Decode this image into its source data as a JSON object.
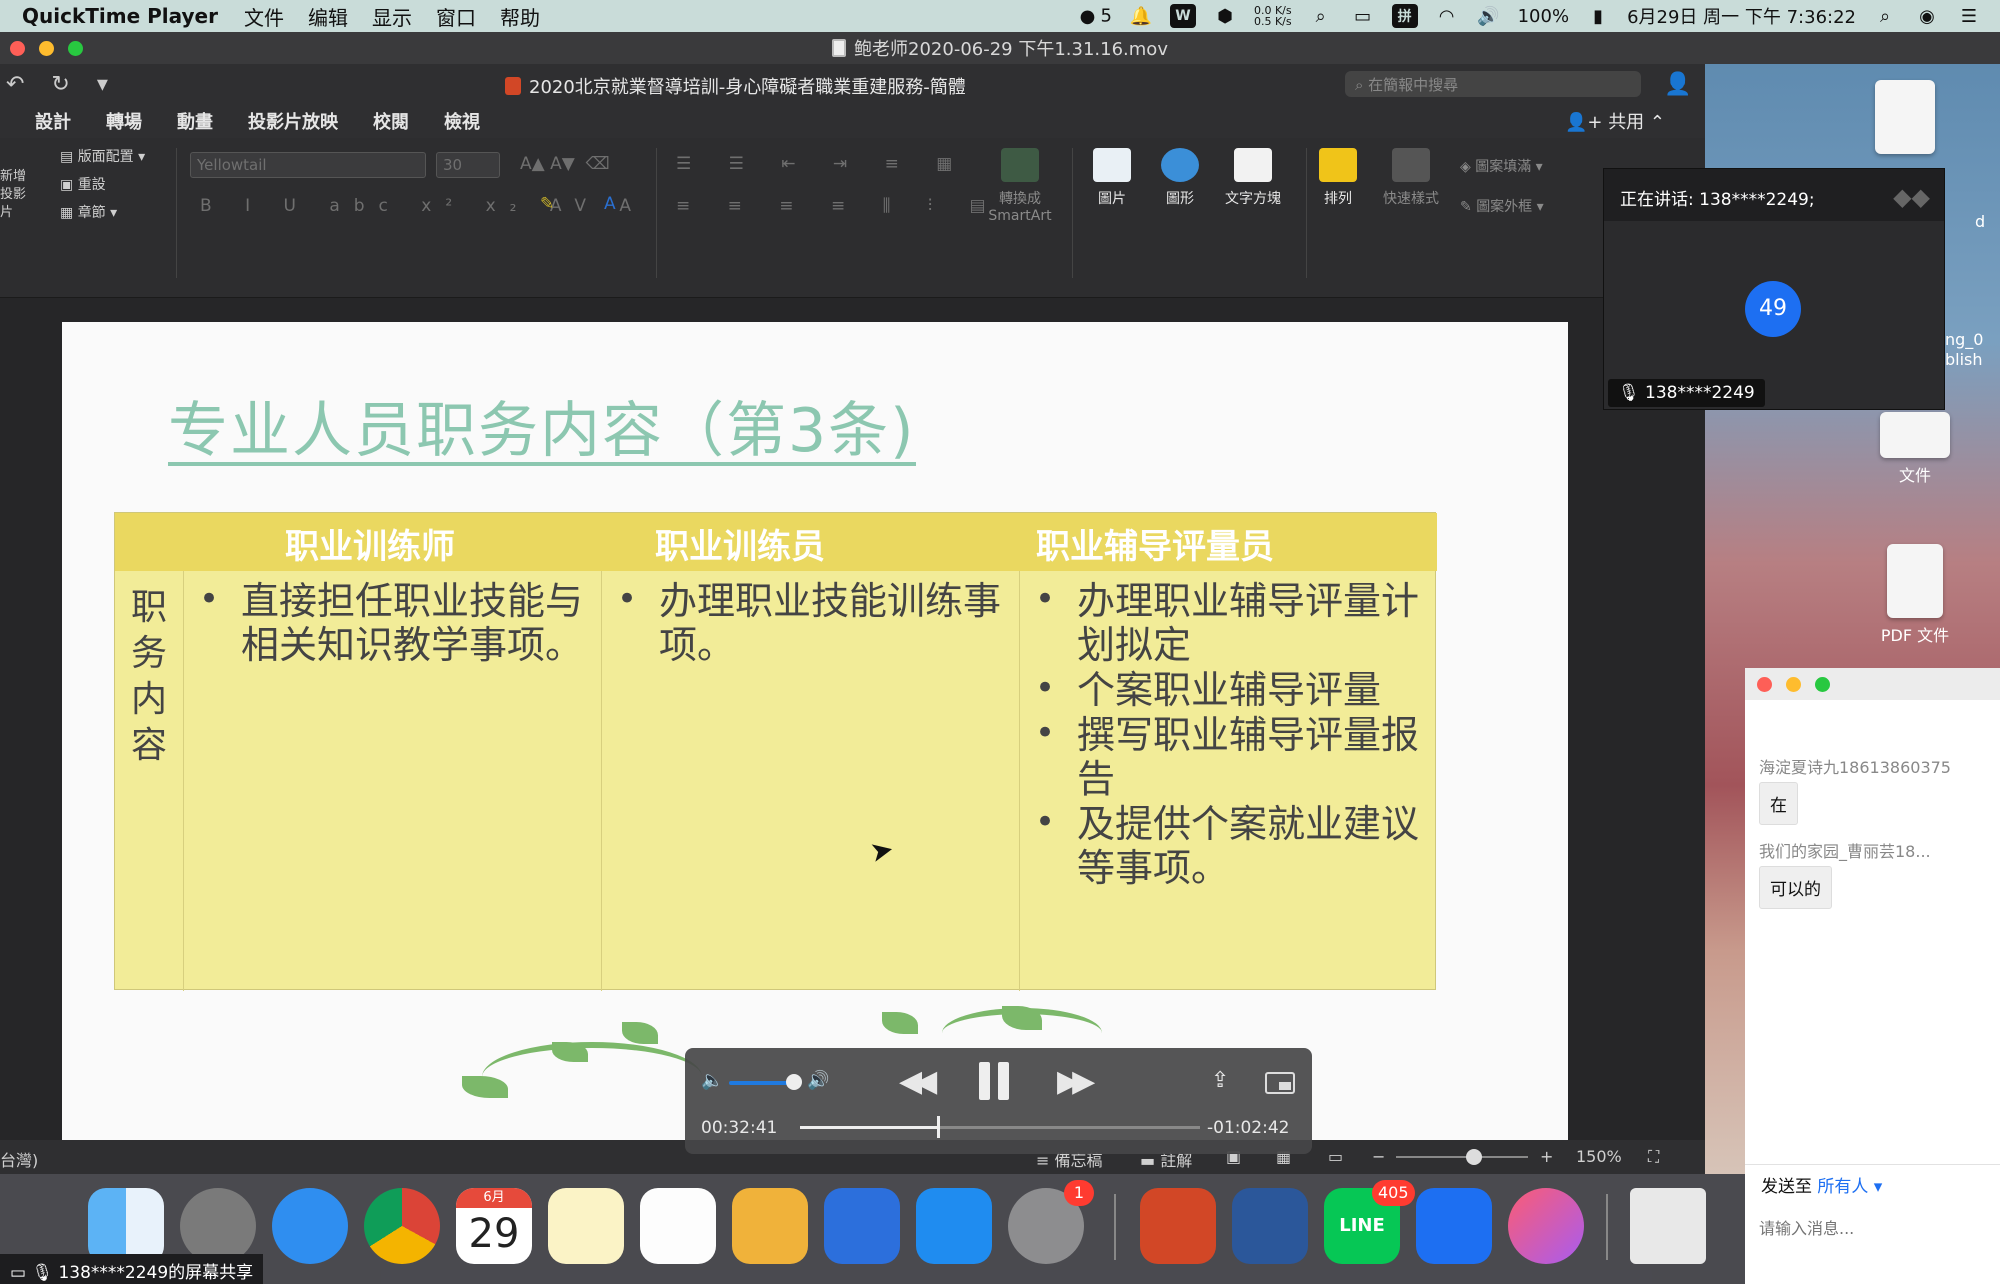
{
  "menubar": {
    "app_name": "QuickTime Player",
    "items": [
      "文件",
      "编辑",
      "显示",
      "窗口",
      "帮助"
    ],
    "wechat_count": "5",
    "net_up": "0.0 K/s",
    "net_down": "0.5 K/s",
    "input_method": "拼",
    "battery": "100%",
    "datetime": "6月29日 周一 下午 7:36:22"
  },
  "qt_window": {
    "title": "鲍老师2020-06-29 下午1.31.16.mov"
  },
  "ppt": {
    "title": "2020北京就業督導培訓-身心障礙者職業重建服務-簡體",
    "search_placeholder": "在簡報中搜尋",
    "tabs": [
      "設計",
      "轉場",
      "動畫",
      "投影片放映",
      "校閱",
      "檢視"
    ],
    "share": "共用",
    "ribbon": {
      "new_slide": "新增投影片",
      "layout": "版面配置",
      "reset": "重設",
      "section": "章節",
      "font_name": "Yellowtail",
      "font_size": "30",
      "smartart": "轉換成SmartArt",
      "picture": "圖片",
      "shape": "圖形",
      "textbox": "文字方塊",
      "arrange": "排列",
      "quick_style": "快速樣式",
      "shape_fill": "圖案填滿",
      "shape_outline": "圖案外框"
    },
    "status": {
      "lang": "台灣)",
      "notes": "備忘稿",
      "comments": "註解",
      "zoom": "150%"
    }
  },
  "slide": {
    "title": "专业人员职务内容（第3条)",
    "headers": [
      "职业训练师",
      "职业训练员",
      "职业辅导评量员"
    ],
    "row_label": "职务内容",
    "col1": [
      "直接担任职业技能与相关知识教学事项。"
    ],
    "col2": [
      "办理职业技能训练事项。"
    ],
    "col3": [
      "办理职业辅导评量计划拟定",
      "个案职业辅导评量",
      "撰写职业辅导评量报告",
      "及提供个案就业建议等事项。"
    ]
  },
  "player": {
    "elapsed": "00:32:41",
    "remaining": "-01:02:42",
    "progress": 0.343,
    "volume": 0.8
  },
  "speaker": {
    "speaking_label": "正在讲话: 138****2249;",
    "avatar_count": "49",
    "name_tag": "138****2249"
  },
  "desktop": {
    "icons": [
      {
        "label": "文件"
      },
      {
        "label": "PDF 文件"
      }
    ],
    "partial_label_1": "ng_0",
    "partial_label_2": "blish",
    "partial_label_3": "d"
  },
  "chat": {
    "messages": [
      {
        "user": "海淀夏诗九18613860375",
        "text": "在"
      },
      {
        "user": "我们的家园_曹丽芸18...",
        "text": "可以的"
      }
    ],
    "send_to_label": "发送至",
    "send_to_target": "所有人",
    "input_placeholder": "请输入消息..."
  },
  "dock": {
    "calendar_month": "6月",
    "calendar_day": "29",
    "settings_badge": "1",
    "line_badge": "405",
    "line_label": "LINE",
    "share_banner": "138****2249的屏幕共享"
  }
}
